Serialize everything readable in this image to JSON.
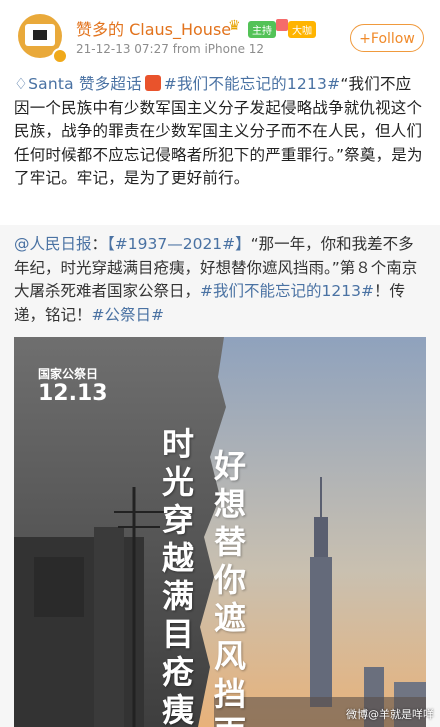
{
  "post": {
    "author": "赞多的 Claus_House",
    "badge_green": "主持",
    "badge_yellow": "大咖",
    "timestamp": "21-12-13 07:27",
    "source": "from iPhone 12",
    "follow_label": "+Follow",
    "super_topic": "Santa 赞多超话",
    "hashtag": "#我们不能忘记的1213#",
    "body": "“我们不应因一个民族中有少数军国主义分子发起侵略战争就仇视这个民族，战争的罪责在少数军国主义分子而不在人民，但人们任何时候都不应忘记侵略者所犯下的严重罪行。”祭奠，是为了牢记。牢记，是为了更好前行。"
  },
  "repost": {
    "source": "@人民日报",
    "hashtag1": "【#1937—2021#】",
    "text1": "“那一年，你和我差不多年纪，时光穿越满目疮痍，好想替你遮风挡雨。”第８个南京大屠杀死难者国家公祭日，",
    "hashtag2": "#我们不能忘记的1213#",
    "text2": "！传递，铭记！",
    "hashtag3": "#公祭日#"
  },
  "poster": {
    "date_label": "国家公祭日",
    "date": "12.13",
    "line1": "时光穿越满目疮痍",
    "line2": "好想替你遮风挡雨"
  },
  "watermark": "微博@羊就是咩咩",
  "colors": {
    "accent": "#f08a2a",
    "link": "#4a72a3",
    "repost_bg": "#f6f6f6"
  }
}
